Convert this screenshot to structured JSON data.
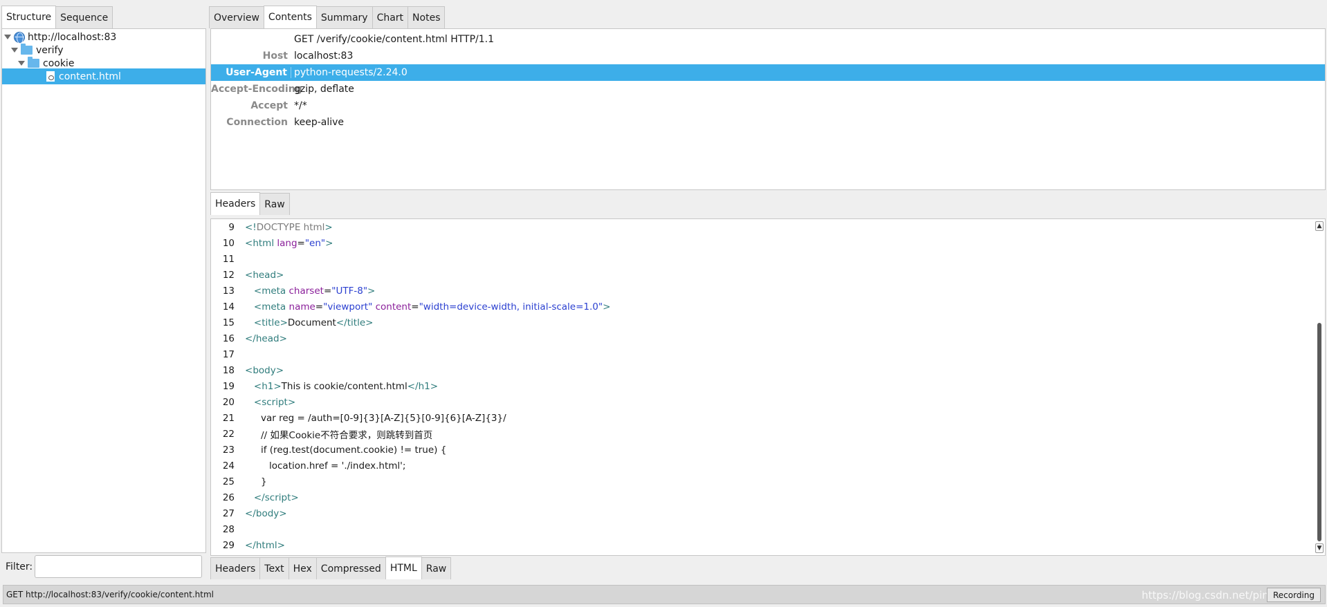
{
  "left_tabs": [
    "Structure",
    "Sequence"
  ],
  "tree": {
    "root": "http://localhost:83",
    "folder1": "verify",
    "folder2": "cookie",
    "file": "content.html"
  },
  "filter": {
    "label": "Filter:",
    "value": ""
  },
  "right_tabs": [
    "Overview",
    "Contents",
    "Summary",
    "Chart",
    "Notes"
  ],
  "request": {
    "line": "GET /verify/cookie/content.html HTTP/1.1",
    "headers": [
      {
        "name": "Host",
        "value": "localhost:83"
      },
      {
        "name": "User-Agent",
        "value": "python-requests/2.24.0"
      },
      {
        "name": "Accept-Encoding",
        "value": "gzip, deflate"
      },
      {
        "name": "Accept",
        "value": "*/*"
      },
      {
        "name": "Connection",
        "value": "keep-alive"
      }
    ]
  },
  "request_tabs": [
    "Headers",
    "Raw"
  ],
  "code": {
    "line_numbers": [
      "9",
      "10",
      "11",
      "12",
      "13",
      "14",
      "15",
      "16",
      "17",
      "18",
      "19",
      "20",
      "21",
      "22",
      "23",
      "24",
      "25",
      "26",
      "27",
      "28",
      "29"
    ],
    "l9": [
      "<!",
      "DOCTYPE html",
      ">"
    ],
    "l10": [
      "<",
      "html",
      " lang",
      "=",
      "\"en\"",
      ">"
    ],
    "l12": [
      "<",
      "head",
      ">"
    ],
    "l13": [
      "<",
      "meta",
      " charset",
      "=",
      "\"UTF-8\"",
      ">"
    ],
    "l14": [
      "<",
      "meta",
      " name",
      "=",
      "\"viewport\"",
      " content",
      "=",
      "\"width=device-width, initial-scale=1.0\"",
      ">"
    ],
    "l15": [
      "<",
      "title",
      ">",
      "Document",
      "</",
      "title",
      ">"
    ],
    "l16": [
      "</",
      "head",
      ">"
    ],
    "l18": [
      "<",
      "body",
      ">"
    ],
    "l19": [
      "<",
      "h1",
      ">",
      "This is cookie/content.html",
      "</",
      "h1",
      ">"
    ],
    "l20": [
      "<",
      "script",
      ">"
    ],
    "l21": "var reg = /auth=[0-9]{3}[A-Z]{5}[0-9]{6}[A-Z]{3}/",
    "l22": "// 如果Cookie不符合要求，则跳转到首页",
    "l23": "if (reg.test(document.cookie) != true) {",
    "l24": "location.href = './index.html';",
    "l25": "}",
    "l26": [
      "</",
      "script",
      ">"
    ],
    "l27": [
      "</",
      "body",
      ">"
    ],
    "l29": [
      "</",
      "html",
      ">"
    ]
  },
  "response_tabs": [
    "Headers",
    "Text",
    "Hex",
    "Compressed",
    "HTML",
    "Raw"
  ],
  "status": {
    "text": "GET http://localhost:83/verify/cookie/content.html",
    "recording": "Recording",
    "watermark": "https://blog.csdn.net/pine"
  }
}
